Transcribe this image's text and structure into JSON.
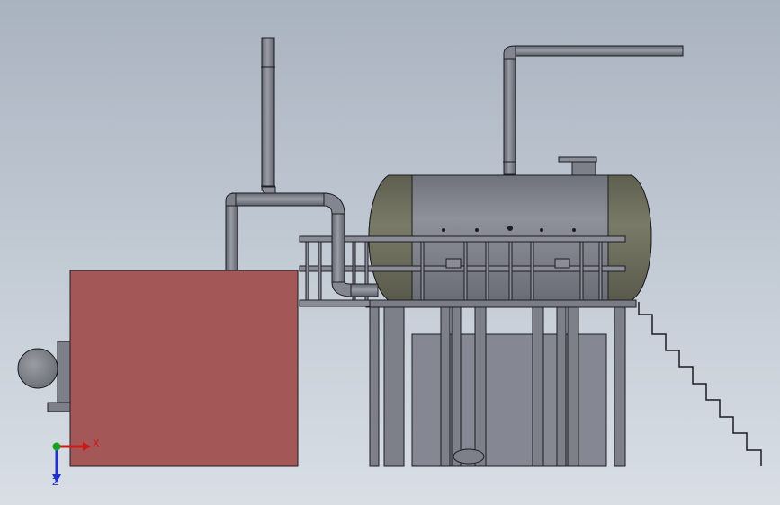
{
  "axes": {
    "x_label": "X",
    "z_label": "Z",
    "x_color": "#d01818",
    "y_color": "#18a020",
    "z_color": "#2030c8"
  },
  "colors": {
    "background_top": "#a9b3bf",
    "background_bottom": "#d9dee5",
    "boiler_body": "#a35757",
    "metal": "#7d8089",
    "metal_dark": "#4c4e56",
    "tank_band": "#6c6c5c",
    "outline": "#1c1c22"
  },
  "icons": [
    "triad-axis-icon"
  ]
}
